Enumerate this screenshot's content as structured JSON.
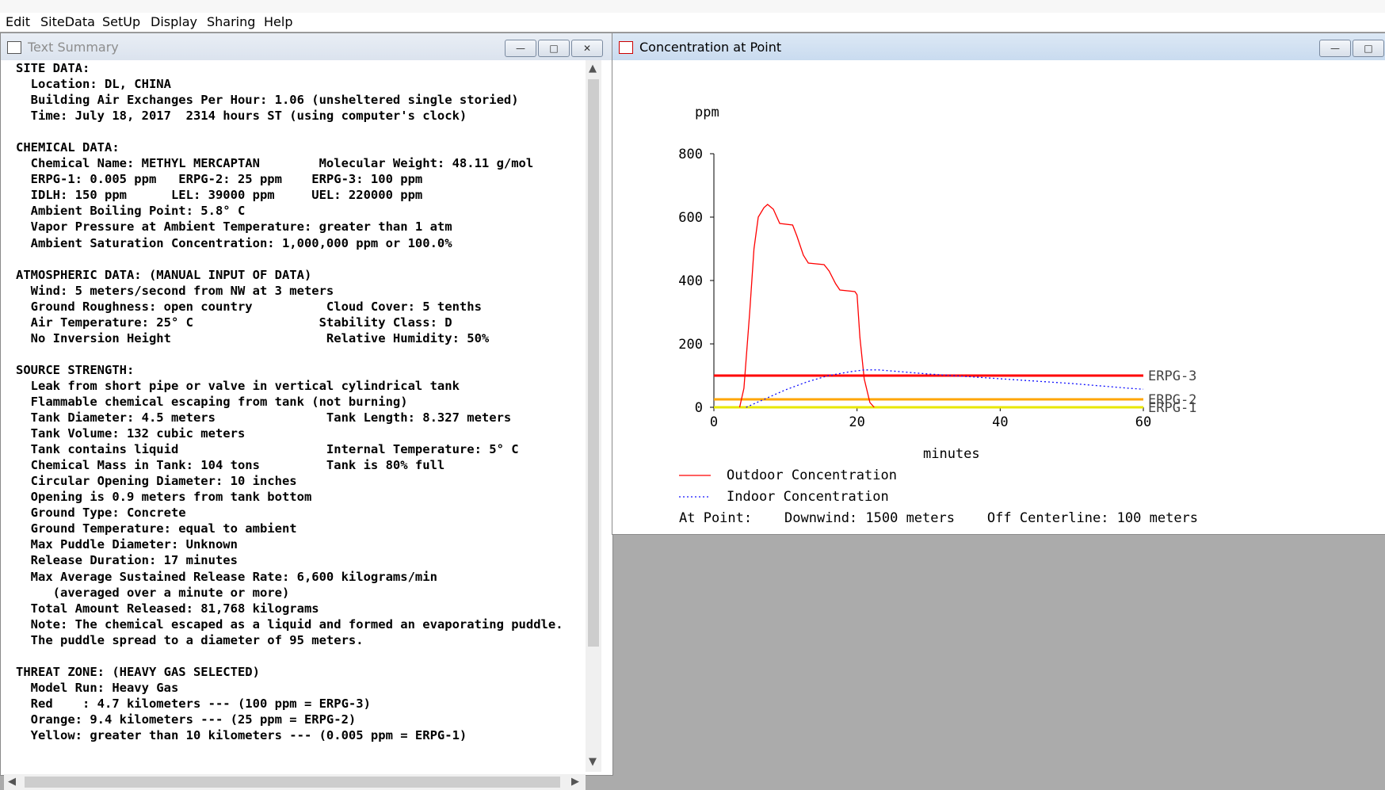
{
  "menu": [
    "Edit",
    "SiteData",
    "SetUp",
    "Display",
    "Sharing",
    "Help"
  ],
  "text_window": {
    "title": "Text Summary",
    "lines": [
      "SITE DATA:",
      "  Location: DL, CHINA",
      "  Building Air Exchanges Per Hour: 1.06 (unsheltered single storied)",
      "  Time: July 18, 2017  2314 hours ST (using computer's clock)",
      "",
      "CHEMICAL DATA:",
      "  Chemical Name: METHYL MERCAPTAN        Molecular Weight: 48.11 g/mol",
      "  ERPG-1: 0.005 ppm   ERPG-2: 25 ppm    ERPG-3: 100 ppm",
      "  IDLH: 150 ppm      LEL: 39000 ppm     UEL: 220000 ppm",
      "  Ambient Boiling Point: 5.8° C",
      "  Vapor Pressure at Ambient Temperature: greater than 1 atm",
      "  Ambient Saturation Concentration: 1,000,000 ppm or 100.0%",
      "",
      "ATMOSPHERIC DATA: (MANUAL INPUT OF DATA)",
      "  Wind: 5 meters/second from NW at 3 meters",
      "  Ground Roughness: open country          Cloud Cover: 5 tenths",
      "  Air Temperature: 25° C                 Stability Class: D",
      "  No Inversion Height                     Relative Humidity: 50%",
      "",
      "SOURCE STRENGTH:",
      "  Leak from short pipe or valve in vertical cylindrical tank",
      "  Flammable chemical escaping from tank (not burning)",
      "  Tank Diameter: 4.5 meters               Tank Length: 8.327 meters",
      "  Tank Volume: 132 cubic meters",
      "  Tank contains liquid                    Internal Temperature: 5° C",
      "  Chemical Mass in Tank: 104 tons         Tank is 80% full",
      "  Circular Opening Diameter: 10 inches",
      "  Opening is 0.9 meters from tank bottom",
      "  Ground Type: Concrete",
      "  Ground Temperature: equal to ambient",
      "  Max Puddle Diameter: Unknown",
      "  Release Duration: 17 minutes",
      "  Max Average Sustained Release Rate: 6,600 kilograms/min",
      "     (averaged over a minute or more)",
      "  Total Amount Released: 81,768 kilograms",
      "  Note: The chemical escaped as a liquid and formed an evaporating puddle.",
      "  The puddle spread to a diameter of 95 meters.",
      "",
      "THREAT ZONE: (HEAVY GAS SELECTED)",
      "  Model Run: Heavy Gas",
      "  Red    : 4.7 kilometers --- (100 ppm = ERPG-3)",
      "  Orange: 9.4 kilometers --- (25 ppm = ERPG-2)",
      "  Yellow: greater than 10 kilometers --- (0.005 ppm = ERPG-1)"
    ]
  },
  "chart_window": {
    "title": "Concentration at Point",
    "legend": {
      "outdoor": "Outdoor Concentration",
      "indoor": "Indoor Concentration"
    },
    "point_info": "At Point:    Downwind: 1500 meters    Off Centerline: 100 meters"
  },
  "chart_data": {
    "type": "line",
    "ylabel": "ppm",
    "xlabel": "minutes",
    "xlim": [
      0,
      60
    ],
    "ylim": [
      0,
      800
    ],
    "x_ticks": [
      0,
      20,
      40,
      60
    ],
    "y_ticks": [
      0,
      200,
      400,
      600,
      800
    ],
    "series": [
      {
        "name": "Outdoor Concentration",
        "color": "#ff0000",
        "style": "solid",
        "x": [
          3.6,
          4.2,
          5.0,
          5.6,
          6.2,
          7.0,
          7.5,
          8.3,
          9.2,
          11.0,
          11.6,
          12.5,
          13.2,
          15.4,
          16.1,
          17.0,
          17.6,
          19.7,
          20.0,
          20.4,
          21.0,
          21.8,
          22.4
        ],
        "y": [
          0,
          60,
          300,
          500,
          600,
          630,
          640,
          625,
          580,
          575,
          540,
          480,
          455,
          450,
          430,
          390,
          370,
          365,
          355,
          220,
          90,
          15,
          0
        ]
      },
      {
        "name": "Indoor Concentration",
        "color": "#1010ff",
        "style": "dotted",
        "x": [
          4.5,
          7.0,
          10.0,
          13.0,
          16.0,
          19.0,
          21.0,
          23.0,
          30.0,
          40.0,
          50.0,
          58.0,
          60.0
        ],
        "y": [
          0,
          25,
          55,
          80,
          100,
          112,
          118,
          118,
          105,
          90,
          75,
          60,
          57
        ]
      }
    ],
    "thresholds": [
      {
        "label": "ERPG-3",
        "value": 100,
        "color": "#ff0000"
      },
      {
        "label": "ERPG-2",
        "value": 25,
        "color": "#ffa500"
      },
      {
        "label": "ERPG-1",
        "value": 0.005,
        "color": "#e8e800"
      }
    ]
  }
}
